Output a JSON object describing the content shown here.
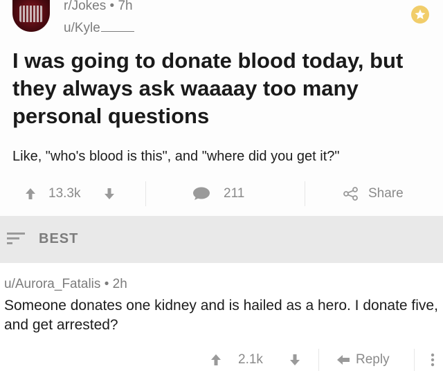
{
  "post": {
    "subreddit": "r/Jokes",
    "time": "7h",
    "meta_separator": "•",
    "author": "u/Kyle",
    "title": "I was going to donate blood today, but they always ask waaaay too many personal questions",
    "body": "Like, \"who's blood is this\", and \"where did you get it?\"",
    "score": "13.3k",
    "comment_count": "211",
    "share_label": "Share"
  },
  "sort": {
    "label": "BEST"
  },
  "comment": {
    "author": "u/Aurora_Fatalis",
    "time": "2h",
    "meta_separator": "•",
    "text": "Someone donates one kidney and is hailed as a hero. I donate five, and get arrested?",
    "score": "2.1k",
    "reply_label": "Reply"
  },
  "colors": {
    "muted_text": "#7c7c7c",
    "icon_gray": "#9a9a9a",
    "sort_bar_bg": "#e9e9e9",
    "gold": "#f1cd6a"
  },
  "icons": {
    "avatar": "subreddit-avatar",
    "gold": "gold-award-icon",
    "upvote": "upvote-arrow-icon",
    "downvote": "downvote-arrow-icon",
    "comment": "speech-bubble-icon",
    "share": "share-icon",
    "sort": "sort-lines-icon",
    "reply": "reply-arrow-icon",
    "more": "more-vertical-icon"
  }
}
